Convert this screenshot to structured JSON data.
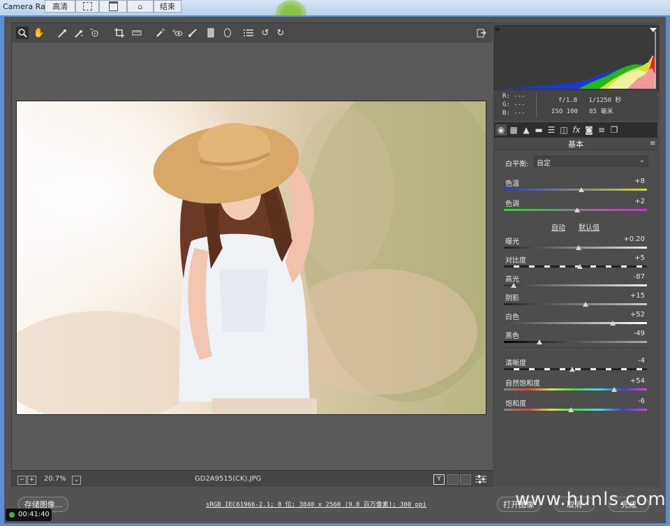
{
  "window": {
    "app_title": "Camera Ra",
    "top_tabs": [
      "高清",
      "",
      "",
      "",
      "结束"
    ]
  },
  "toolbar": {
    "tools": [
      "zoom-icon",
      "hand-icon",
      "white-balance-icon",
      "color-sampler-icon",
      "target-adjust-icon",
      "crop-icon",
      "straighten-icon",
      "spot-removal-icon",
      "red-eye-icon",
      "adjustment-brush-icon",
      "graduated-filter-icon",
      "radial-filter-icon",
      "list-icon",
      "rotate-left-icon",
      "rotate-right-icon"
    ]
  },
  "preview": {
    "zoom": "20.7%",
    "filename": "GD2A9515(CK).JPG"
  },
  "info": {
    "r": "R:  ---",
    "g": "G:  ---",
    "b": "B:  ---",
    "aperture_shutter": "f/1.8   1/1250 秒",
    "iso_focal": "ISO 100   85 毫米"
  },
  "panel": {
    "title": "基本",
    "wb_label": "白平衡:",
    "wb_value": "自定",
    "auto": "自动",
    "default": "默认值",
    "sliders": [
      {
        "label": "色温",
        "value": "+8",
        "pos": 0.54
      },
      {
        "label": "色调",
        "value": "+2",
        "pos": 0.51
      },
      {
        "label": "曝光",
        "value": "+0.20",
        "pos": 0.52
      },
      {
        "label": "对比度",
        "value": "+5",
        "pos": 0.53
      },
      {
        "label": "高光",
        "value": "-87",
        "pos": 0.07
      },
      {
        "label": "阴影",
        "value": "+15",
        "pos": 0.57
      },
      {
        "label": "白色",
        "value": "+52",
        "pos": 0.76
      },
      {
        "label": "黑色",
        "value": "-49",
        "pos": 0.25
      },
      {
        "label": "清晰度",
        "value": "-4",
        "pos": 0.48
      },
      {
        "label": "自然饱和度",
        "value": "+54",
        "pos": 0.77
      },
      {
        "label": "饱和度",
        "value": "-6",
        "pos": 0.47
      }
    ]
  },
  "bottom": {
    "save_label": "存储图像...",
    "workflow": "sRGB IEC61966-2.1; 8 位; 3840 x 2560 (9.8 百万像素); 300 ppi",
    "open_label": "打开图像",
    "cancel_label": "取消",
    "done_label": "完成"
  },
  "watermark": "www.hunls.com",
  "timer": "00:41:40"
}
